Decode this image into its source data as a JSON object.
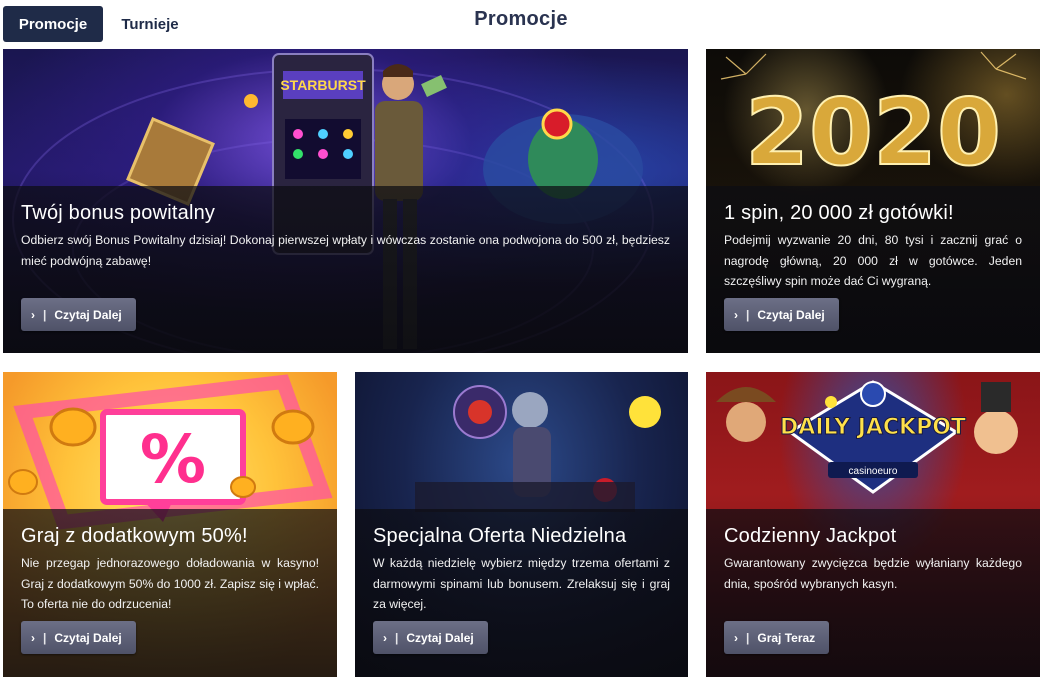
{
  "tabs": [
    {
      "label": "Promocje",
      "active": true
    },
    {
      "label": "Turnieje",
      "active": false
    }
  ],
  "page_title": "Promocje",
  "colors": {
    "tab_active_bg": "#1f2b48",
    "title_color": "#2a3350",
    "button_bg": "#5d6078"
  },
  "promotions": [
    {
      "title": "Twój bonus powitalny",
      "description": "Odbierz swój Bonus Powitalny dzisiaj! Dokonaj pierwszej wpłaty i wówczas zostanie ona podwojona do 500 zł, będziesz mieć podwójną zabawę!",
      "button_label": "Czytaj Dalej",
      "art": "starburst-slot-explorer-banner",
      "art_text": "STARBURST"
    },
    {
      "title": "1 spin, 20 000 zł gotówki!",
      "description": "Podejmij wyzwanie 20 dni, 80 tysi i zacznij grać o nagrodę główną, 20 000 zł w gotówce. Jeden szczęśliwy spin może dać Ci wygraną.",
      "button_label": "Czytaj Dalej",
      "art": "gold-2020-fireworks-banner",
      "art_text": "2020"
    },
    {
      "title": "Graj z dodatkowym 50%!",
      "description": "Nie przegap jednorazowego doładowania w kasyno! Graj z dodatkowym 50% do 1000 zł. Zapisz się i wpłać. To oferta nie do odrzucenia!",
      "button_label": "Czytaj Dalej",
      "art": "percent-sign-coins-banner",
      "art_text": "%"
    },
    {
      "title": "Specjalna Oferta Niedzielna",
      "description": "W każdą niedzielę wybierz między trzema ofertami z darmowymi spinami lub bonusem. Zrelaksuj się i graj za więcej.",
      "button_label": "Czytaj Dalej",
      "art": "conquistador-space-banner",
      "art_text": ""
    },
    {
      "title": "Codzienny Jackpot",
      "description": "Gwarantowany zwycięzca będzie wyłaniany każdego dnia, spośród wybranych kasyn.",
      "button_label": "Graj Teraz",
      "art": "daily-jackpot-characters-banner",
      "art_text": "DAILY JACKPOT",
      "art_subtext": "casinoeuro"
    }
  ],
  "icons": {
    "button_chevron": "chevron-right-icon",
    "chevron_glyph": "›",
    "separator_glyph": "|"
  }
}
